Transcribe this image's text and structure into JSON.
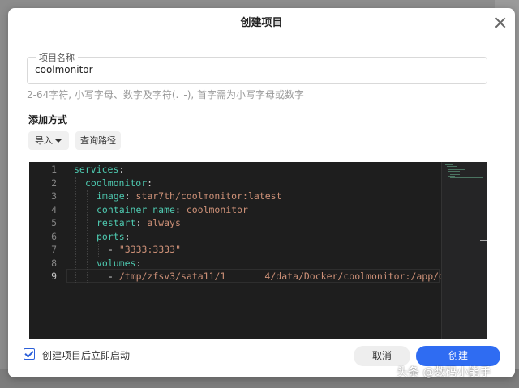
{
  "dialog": {
    "title": "创建项目",
    "name_field": {
      "legend": "项目名称",
      "value": "coolmonitor"
    },
    "hint": "2-64字符, 小写字母、数字及字符(._-), 首字需为小写字母或数字",
    "add_method": {
      "title": "添加方式",
      "import_label": "导入",
      "path_label": "查询路径"
    },
    "editor": {
      "line_numbers": [
        "1",
        "2",
        "3",
        "4",
        "5",
        "6",
        "7",
        "8",
        "9"
      ],
      "current_line": "9",
      "lines": [
        {
          "key": "services",
          "sep": ":",
          "value": ""
        },
        {
          "key": "coolmonitor",
          "sep": ":",
          "value": ""
        },
        {
          "key": "image",
          "sep": ": ",
          "value": "star7th/coolmonitor:latest"
        },
        {
          "key": "container_name",
          "sep": ": ",
          "value": "coolmonitor"
        },
        {
          "key": "restart",
          "sep": ": ",
          "value": "always"
        },
        {
          "key": "ports",
          "sep": ":",
          "value": ""
        },
        {
          "key": "",
          "sep": "- ",
          "value": "\"3333:3333\""
        },
        {
          "key": "volumes",
          "sep": ":",
          "value": ""
        },
        {
          "key": "",
          "sep": "- ",
          "value": "/tmp/zfsv3/sata11/1",
          "value2": "4/data/Docker/coolmonitor",
          "value3": ":/app/d"
        }
      ]
    },
    "footer": {
      "autostart_label": "创建项目后立即启动",
      "autostart_checked": true,
      "cancel_label": "取消",
      "create_label": "创建"
    }
  },
  "watermark": "头条 @数码小能手",
  "colors": {
    "accent": "#2f6cf2",
    "editor_bg": "#1e1e1e",
    "code_key": "#4ec9b0",
    "code_string": "#ce9178"
  }
}
